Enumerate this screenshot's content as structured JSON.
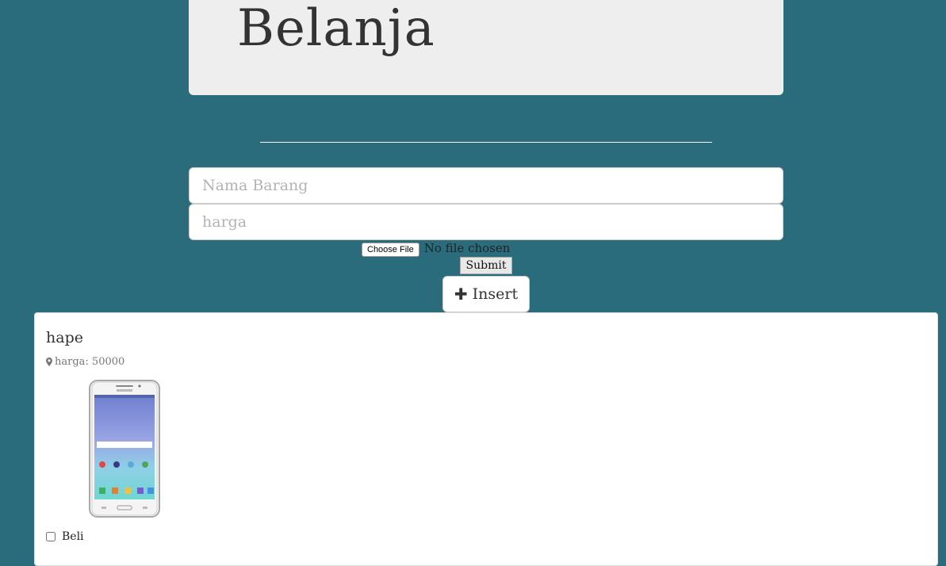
{
  "header": {
    "title": "Belanja"
  },
  "form": {
    "nama_placeholder": "Nama Barang",
    "harga_placeholder": "harga",
    "file_button_label": "Choose File",
    "file_status": "No file chosen",
    "submit_label": "Submit",
    "insert_label": "Insert",
    "insert_icon": "plus-icon"
  },
  "items": [
    {
      "name": "hape",
      "price_label": "harga: 50000",
      "price_icon": "map-marker-icon",
      "image": "samsung-phone-image",
      "checkbox_label": "Beli",
      "checked": false
    }
  ],
  "colors": {
    "background": "#2b6c7c",
    "jumbotron": "#eeeeee",
    "card": "#ffffff"
  }
}
